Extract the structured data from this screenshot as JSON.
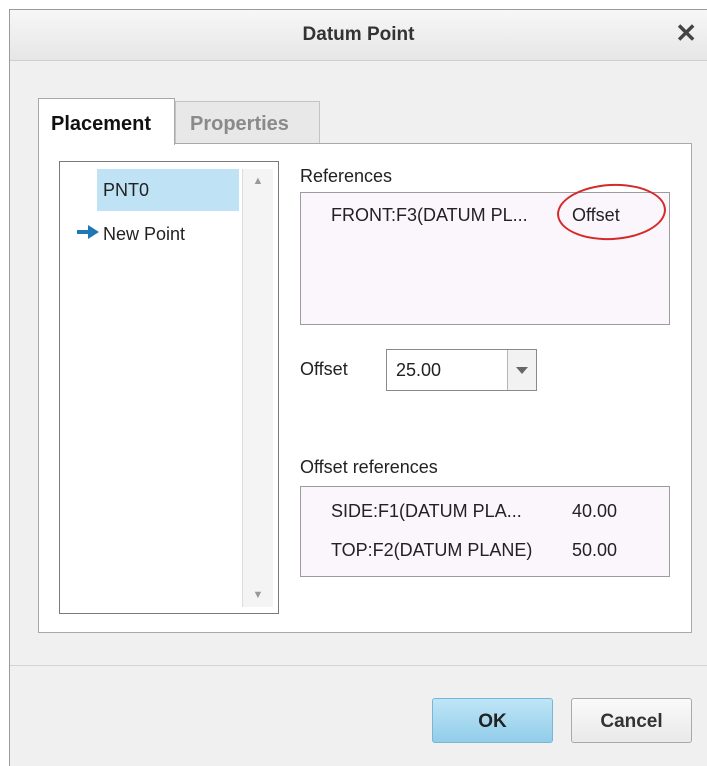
{
  "window": {
    "title": "Datum Point"
  },
  "tabs": [
    {
      "label": "Placement"
    },
    {
      "label": "Properties"
    }
  ],
  "points_list": {
    "items": [
      {
        "label": "PNT0"
      },
      {
        "label": "New Point"
      }
    ]
  },
  "references": {
    "label": "References",
    "rows": [
      {
        "reference": "FRONT:F3(DATUM PL...",
        "type": "Offset"
      }
    ]
  },
  "offset": {
    "label": "Offset",
    "value": "25.00"
  },
  "offset_references": {
    "label": "Offset references",
    "rows": [
      {
        "reference": "SIDE:F1(DATUM PLA...",
        "value": "40.00"
      },
      {
        "reference": "TOP:F2(DATUM PLANE)",
        "value": "50.00"
      }
    ]
  },
  "buttons": {
    "ok": "OK",
    "cancel": "Cancel"
  },
  "colors": {
    "accent": "#91cdea",
    "selection": "#bfe3f5",
    "highlight_circle": "#d42a2a",
    "arrow": "#1f77b4"
  },
  "icons": {
    "close": "close-icon",
    "current_point": "arrow-right-icon",
    "dropdown": "chevron-down-icon"
  }
}
